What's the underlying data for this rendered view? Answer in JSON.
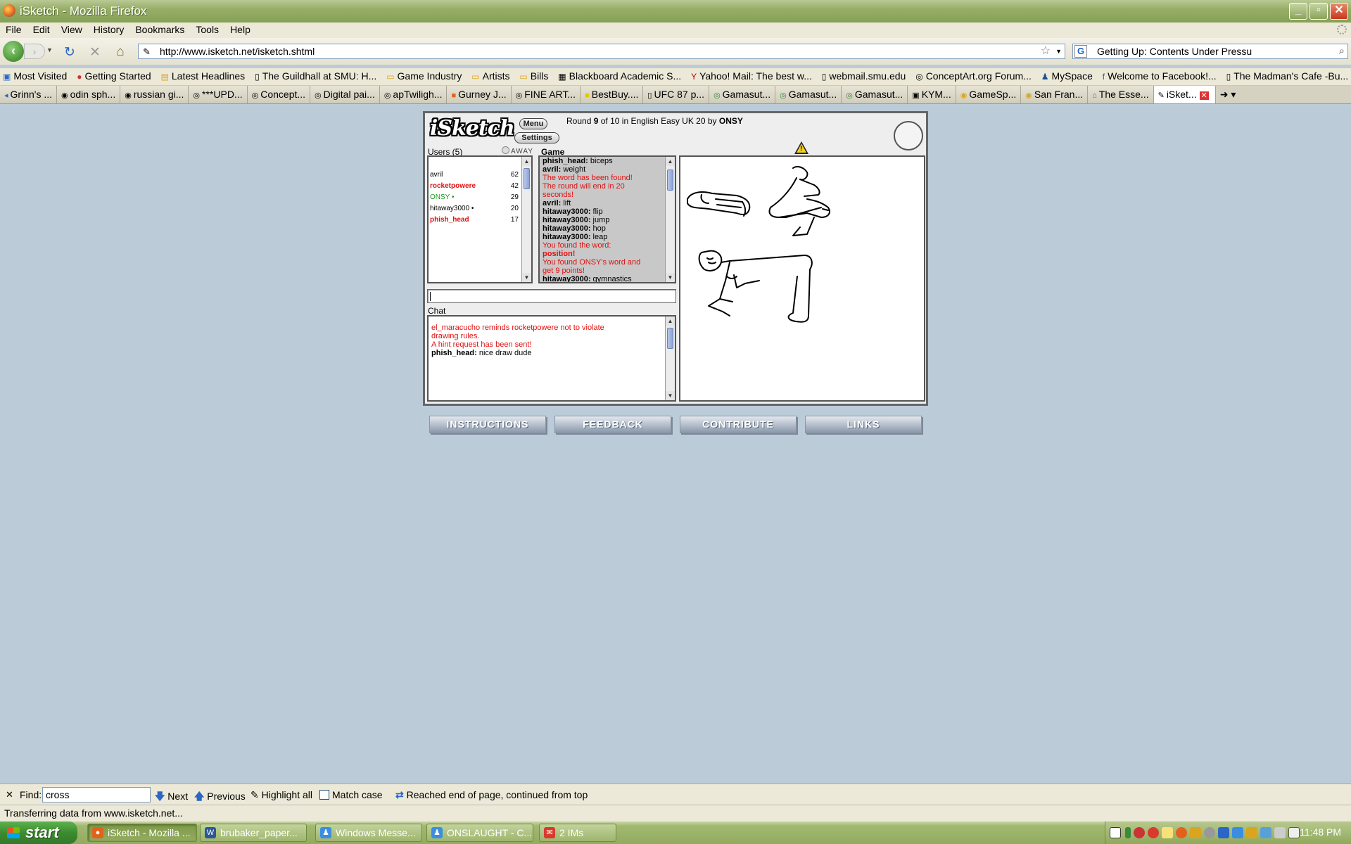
{
  "window": {
    "title": "iSketch - Mozilla Firefox"
  },
  "menu": [
    "File",
    "Edit",
    "View",
    "History",
    "Bookmarks",
    "Tools",
    "Help"
  ],
  "nav": {
    "url": "http://www.isketch.net/isketch.shtml",
    "search_text": "Getting Up: Contents Under Pressu"
  },
  "bookmarks": [
    "Most Visited",
    "Getting Started",
    "Latest Headlines",
    "The Guildhall at SMU: H...",
    "Game Industry",
    "Artists",
    "Bills",
    "Blackboard Academic S...",
    "Yahoo! Mail: The best w...",
    "webmail.smu.edu",
    "ConceptArt.org Forum...",
    "MySpace",
    "Welcome to Facebook!...",
    "The Madman's Cafe -Bu..."
  ],
  "tabs": [
    "Grinn's ...",
    "odin sph...",
    "russian gi...",
    "***UPD...",
    "Concept...",
    "Digital pai...",
    "apTwiligh...",
    "Gurney J...",
    "FINE ART...",
    "BestBuy....",
    "UFC 87 p...",
    "Gamasut...",
    "Gamasut...",
    "Gamasut...",
    "KYM...",
    "GameSp...",
    "San Fran...",
    "The Esse...",
    "iSket..."
  ],
  "app": {
    "logo": "iSketch",
    "menu_button": "Menu",
    "settings_button": "Settings",
    "round": {
      "prefix": "Round",
      "current": "9",
      "of": "of 10 in English Easy UK 20 by",
      "host": "ONSY"
    },
    "users_label": "Users (5)",
    "away_label": "AWAY",
    "game_label": "Game",
    "chat_label": "Chat",
    "users": [
      {
        "name": "avril",
        "score": "62",
        "color": "#000000",
        "bold": false
      },
      {
        "name": "rocketpowere",
        "score": "42",
        "color": "#e01010",
        "bold": true
      },
      {
        "name": "ONSY •",
        "score": "29",
        "color": "#1a9a1a",
        "bold": false
      },
      {
        "name": "hitaway3000 •",
        "score": "20",
        "color": "#000000",
        "bold": false
      },
      {
        "name": "phish_head",
        "score": "17",
        "color": "#e01010",
        "bold": true
      }
    ],
    "game_log": [
      {
        "who": "phish_head:",
        "text": "biceps",
        "red": false
      },
      {
        "who": "avril:",
        "text": "weight",
        "red": false
      },
      {
        "who": "",
        "text": "The word has been found!",
        "red": true
      },
      {
        "who": "",
        "text": "The round will end in 20",
        "red": true
      },
      {
        "who": "",
        "text": "seconds!",
        "red": true
      },
      {
        "who": "avril:",
        "text": "lift",
        "red": false
      },
      {
        "who": "hitaway3000:",
        "text": "flip",
        "red": false
      },
      {
        "who": "hitaway3000:",
        "text": "jump",
        "red": false
      },
      {
        "who": "hitaway3000:",
        "text": "hop",
        "red": false
      },
      {
        "who": "hitaway3000:",
        "text": "leap",
        "red": false
      },
      {
        "who": "",
        "text": "You found the word:",
        "red": true
      },
      {
        "who": "position!",
        "text": "",
        "red": true
      },
      {
        "who": "",
        "text": "You found ONSY's word and",
        "red": true
      },
      {
        "who": "",
        "text": "get 9 points!",
        "red": true
      },
      {
        "who": "hitaway3000:",
        "text": "gymnastics",
        "red": false
      }
    ],
    "chat_log": [
      {
        "who": "",
        "text": "el_maracucho reminds rocketpowere not to violate",
        "red": true
      },
      {
        "who": "",
        "text": "drawing rules.",
        "red": true
      },
      {
        "who": "",
        "text": "A hint request has been sent!",
        "red": true
      },
      {
        "who": "phish_head:",
        "text": "nice draw dude",
        "red": false
      }
    ],
    "bottom_links": [
      "INSTRUCTIONS",
      "FEEDBACK",
      "CONTRIBUTE",
      "LINKS"
    ]
  },
  "findbar": {
    "label": "Find:",
    "query": "cross",
    "next": "Next",
    "previous": "Previous",
    "highlight": "Highlight all",
    "match_case": "Match case",
    "message": "Reached end of page, continued from top"
  },
  "status": "Transferring data from www.isketch.net...",
  "taskbar": {
    "start": "start",
    "items": [
      {
        "label": "iSketch - Mozilla ...",
        "icon_color": "#e2621b"
      },
      {
        "label": "brubaker_paper...",
        "icon_color": "#2b5797"
      },
      {
        "label": "Windows Messe...",
        "icon_color": "#3a8de0"
      },
      {
        "label": "ONSLAUGHT - C...",
        "icon_color": "#3a8de0"
      },
      {
        "label": "2 IMs",
        "icon_color": "#d83b2b"
      }
    ],
    "clock": "11:48 PM"
  }
}
